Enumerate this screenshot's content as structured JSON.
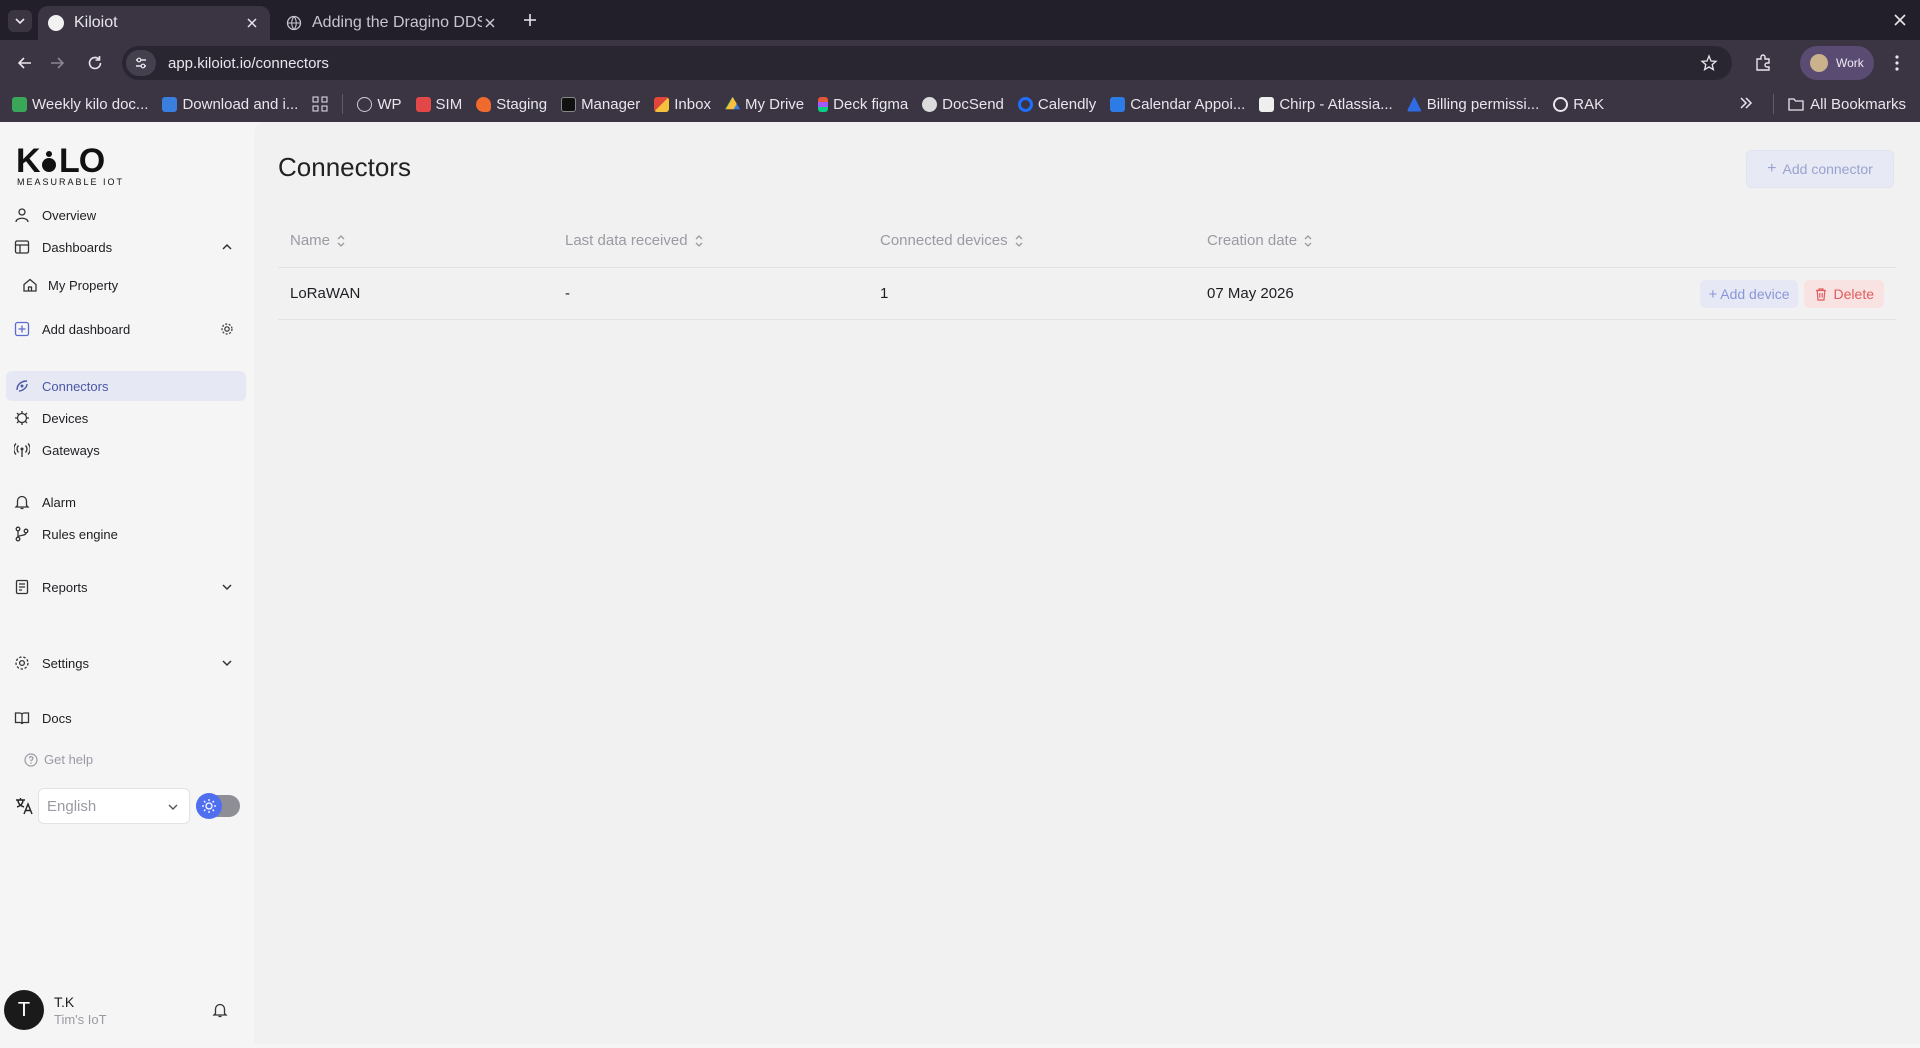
{
  "browser": {
    "tabs": [
      {
        "title": "Kiloiot",
        "active": true
      },
      {
        "title": "Adding the Dragino DDS",
        "active": false
      }
    ],
    "url": "app.kiloiot.io/connectors",
    "profile_label": "Work",
    "bookmarks": [
      {
        "label": "Weekly kilo doc...",
        "icon": "check-square-icon",
        "color": "#3aa657"
      },
      {
        "label": "Download and i...",
        "icon": "check-square-icon",
        "color": "#3a7ee0"
      },
      {
        "label": "WP",
        "icon": "globe-icon",
        "color": "#cfcbd6"
      },
      {
        "label": "SIM",
        "icon": "sim-icon",
        "color": "#e24848"
      },
      {
        "label": "Staging",
        "icon": "fire-icon",
        "color": "#ef6a2c"
      },
      {
        "label": "Manager",
        "icon": "manager-icon",
        "color": "#111111"
      },
      {
        "label": "Inbox",
        "icon": "gmail-icon",
        "color": "#e0463a"
      },
      {
        "label": "My Drive",
        "icon": "drive-icon",
        "color": "#2fa44f"
      },
      {
        "label": "Deck figma",
        "icon": "figma-icon",
        "color": "#e8563a"
      },
      {
        "label": "DocSend",
        "icon": "docsend-icon",
        "color": "#dcdcdc"
      },
      {
        "label": "Calendly",
        "icon": "calendly-icon",
        "color": "#1f6fff"
      },
      {
        "label": "Calendar Appoi...",
        "icon": "calendar-icon",
        "color": "#2d7be5"
      },
      {
        "label": "Chirp - Atlassia...",
        "icon": "chirp-icon",
        "color": "#efefef"
      },
      {
        "label": "Billing permissi...",
        "icon": "atlassian-icon",
        "color": "#2f6be3"
      },
      {
        "label": "RAK",
        "icon": "rak-icon",
        "color": "#e8e6ec"
      }
    ],
    "all_bookmarks": "All Bookmarks"
  },
  "sidebar": {
    "logo_text": "KILO",
    "logo_tagline": "MEASURABLE IOT",
    "overview": "Overview",
    "dashboards": "Dashboards",
    "my_property": "My Property",
    "add_dashboard": "Add dashboard",
    "connectors": "Connectors",
    "devices": "Devices",
    "gateways": "Gateways",
    "alarm": "Alarm",
    "rules_engine": "Rules engine",
    "reports": "Reports",
    "settings": "Settings",
    "docs": "Docs",
    "get_help": "Get help",
    "language": "English",
    "user": {
      "initial": "T",
      "name": "T.K",
      "org": "Tim's IoT"
    }
  },
  "main": {
    "title": "Connectors",
    "add_connector": "Add connector",
    "columns": [
      "Name",
      "Last data received",
      "Connected devices",
      "Creation date"
    ],
    "rows": [
      {
        "name": "LoRaWAN",
        "last_data": "-",
        "connected_devices": "1",
        "creation_date": "07 May 2026"
      }
    ],
    "add_device": "Add device",
    "delete": "Delete"
  },
  "colors": {
    "accent": "#4a57a8",
    "danger": "#e05d5d",
    "chrome_bg": "#3a3443"
  }
}
